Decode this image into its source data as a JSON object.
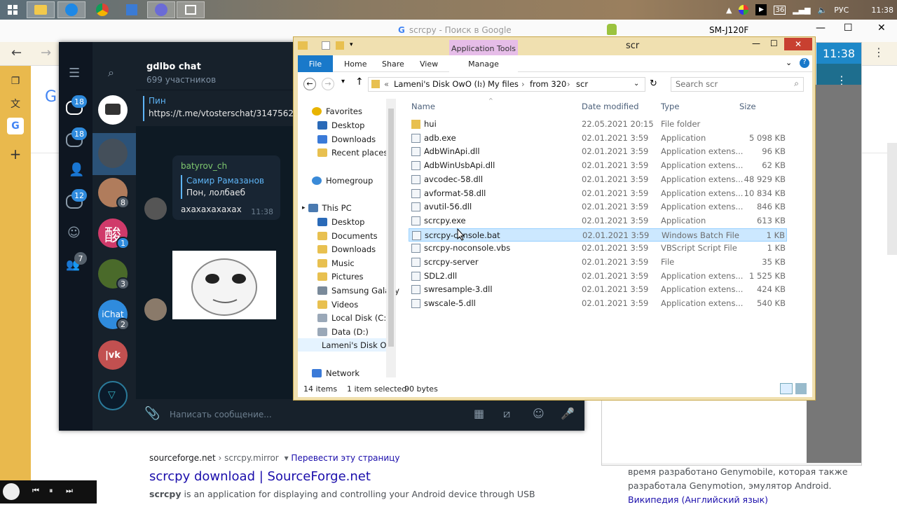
{
  "taskbar": {
    "lang": "РУС",
    "time": "11:38",
    "badge": "36"
  },
  "chrome": {
    "tab_title": "scrcpy - Поиск в Google"
  },
  "phone": {
    "title": "SM-J120F",
    "time": "11:38"
  },
  "telegram": {
    "chat_title": "gdlbo chat",
    "members": "699 участников",
    "pin_label": "Пин",
    "pin_link": "https://t.me/vtosterschat/3147562",
    "msg_author": "batyrov_ch",
    "reply_author": "Самир Рамазанов",
    "reply_text": "Пон, лолбаеб",
    "msg_text": "ахахахахахах",
    "msg_time": "11:38",
    "input_placeholder": "Написать сообщение...",
    "badges": [
      "18",
      "18",
      "12",
      "7"
    ],
    "list_badges": [
      "8",
      "1",
      "3",
      "2"
    ],
    "avatar_kanji": "酸",
    "avatar_chat": "iChat",
    "avatar_vk": "|vk"
  },
  "explorer": {
    "title": "scr",
    "app_tools": "Application Tools",
    "tabs": {
      "file": "File",
      "home": "Home",
      "share": "Share",
      "view": "View",
      "manage": "Manage"
    },
    "breadcrumb": [
      "Lameni's Disk OwO (I:)",
      "My files",
      "from 320",
      "scr"
    ],
    "breadcrumb_prefix": "«",
    "search_placeholder": "Search scr",
    "columns": {
      "name": "Name",
      "date": "Date modified",
      "type": "Type",
      "size": "Size"
    },
    "nav": {
      "favorites": "Favorites",
      "desktop": "Desktop",
      "downloads": "Downloads",
      "recent": "Recent places",
      "homegroup": "Homegroup",
      "thispc": "This PC",
      "pc_desktop": "Desktop",
      "documents": "Documents",
      "pc_downloads": "Downloads",
      "music": "Music",
      "pictures": "Pictures",
      "samsung": "Samsung Galaxy",
      "videos": "Videos",
      "c": "Local Disk (C:)",
      "d": "Data (D:)",
      "i": "Lameni's Disk O",
      "network": "Network"
    },
    "files": [
      {
        "name": "hui",
        "date": "22.05.2021 20:15",
        "type": "File folder",
        "size": ""
      },
      {
        "name": "adb.exe",
        "date": "02.01.2021 3:59",
        "type": "Application",
        "size": "5 098 KB"
      },
      {
        "name": "AdbWinApi.dll",
        "date": "02.01.2021 3:59",
        "type": "Application extens...",
        "size": "96 KB"
      },
      {
        "name": "AdbWinUsbApi.dll",
        "date": "02.01.2021 3:59",
        "type": "Application extens...",
        "size": "62 KB"
      },
      {
        "name": "avcodec-58.dll",
        "date": "02.01.2021 3:59",
        "type": "Application extens...",
        "size": "48 929 KB"
      },
      {
        "name": "avformat-58.dll",
        "date": "02.01.2021 3:59",
        "type": "Application extens...",
        "size": "10 834 KB"
      },
      {
        "name": "avutil-56.dll",
        "date": "02.01.2021 3:59",
        "type": "Application extens...",
        "size": "846 KB"
      },
      {
        "name": "scrcpy.exe",
        "date": "02.01.2021 3:59",
        "type": "Application",
        "size": "613 KB"
      },
      {
        "name": "scrcpy-console.bat",
        "date": "02.01.2021 3:59",
        "type": "Windows Batch File",
        "size": "1 KB"
      },
      {
        "name": "scrcpy-noconsole.vbs",
        "date": "02.01.2021 3:59",
        "type": "VBScript Script File",
        "size": "1 KB"
      },
      {
        "name": "scrcpy-server",
        "date": "02.01.2021 3:59",
        "type": "File",
        "size": "35 KB"
      },
      {
        "name": "SDL2.dll",
        "date": "02.01.2021 3:59",
        "type": "Application extens...",
        "size": "1 525 KB"
      },
      {
        "name": "swresample-3.dll",
        "date": "02.01.2021 3:59",
        "type": "Application extens...",
        "size": "424 KB"
      },
      {
        "name": "swscale-5.dll",
        "date": "02.01.2021 3:59",
        "type": "Application extens...",
        "size": "540 KB"
      }
    ],
    "status_items": "14 items",
    "status_selected": "1 item selected",
    "status_size": "90 bytes"
  },
  "google": {
    "breadcrumb_site": "sourceforge.net",
    "breadcrumb_path": "› scrcpy.mirror",
    "translate": "Перевести эту страницу",
    "result_title": "scrcpy download | SourceForge.net",
    "snippet_bold": "scrcpy",
    "snippet_rest": " is an application for displaying and controlling your Android device through USB",
    "side_text1": "время разработано Genymobile, которая также",
    "side_text2": "разработала Genymotion, эмулятор Android.",
    "side_link": "Википедия (Английский язык)"
  }
}
